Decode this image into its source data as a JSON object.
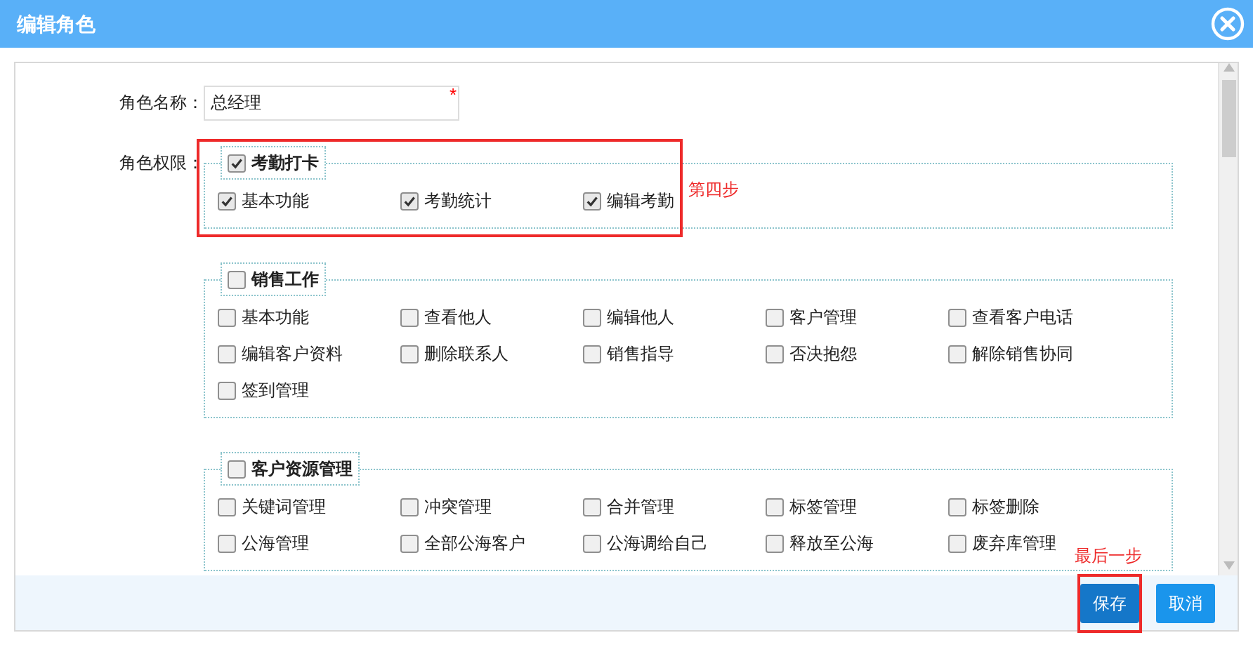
{
  "dialog": {
    "title": "编辑角色"
  },
  "form": {
    "name_label": "角色名称：",
    "name_value": "总经理",
    "required_mark": "*",
    "permissions_label": "角色权限："
  },
  "groups": [
    {
      "title": "考勤打卡",
      "checked": true,
      "items": [
        {
          "label": "基本功能",
          "checked": true
        },
        {
          "label": "考勤统计",
          "checked": true
        },
        {
          "label": "编辑考勤",
          "checked": true
        }
      ]
    },
    {
      "title": "销售工作",
      "checked": false,
      "items": [
        {
          "label": "基本功能",
          "checked": false
        },
        {
          "label": "查看他人",
          "checked": false
        },
        {
          "label": "编辑他人",
          "checked": false
        },
        {
          "label": "客户管理",
          "checked": false
        },
        {
          "label": "查看客户电话",
          "checked": false
        },
        {
          "label": "编辑客户资料",
          "checked": false
        },
        {
          "label": "删除联系人",
          "checked": false
        },
        {
          "label": "销售指导",
          "checked": false
        },
        {
          "label": "否决抱怨",
          "checked": false
        },
        {
          "label": "解除销售协同",
          "checked": false
        },
        {
          "label": "签到管理",
          "checked": false
        }
      ]
    },
    {
      "title": "客户资源管理",
      "checked": false,
      "items": [
        {
          "label": "关键词管理",
          "checked": false
        },
        {
          "label": "冲突管理",
          "checked": false
        },
        {
          "label": "合并管理",
          "checked": false
        },
        {
          "label": "标签管理",
          "checked": false
        },
        {
          "label": "标签删除",
          "checked": false
        },
        {
          "label": "公海管理",
          "checked": false
        },
        {
          "label": "全部公海客户",
          "checked": false
        },
        {
          "label": "公海调给自己",
          "checked": false
        },
        {
          "label": "释放至公海",
          "checked": false
        },
        {
          "label": "废弃库管理",
          "checked": false
        }
      ]
    }
  ],
  "annotations": [
    {
      "text": "第四步",
      "kind": "section"
    },
    {
      "text": "最后一步",
      "kind": "button"
    }
  ],
  "buttons": [
    {
      "label": "保存",
      "kind": "primary"
    },
    {
      "label": "取消",
      "kind": "secondary"
    }
  ]
}
